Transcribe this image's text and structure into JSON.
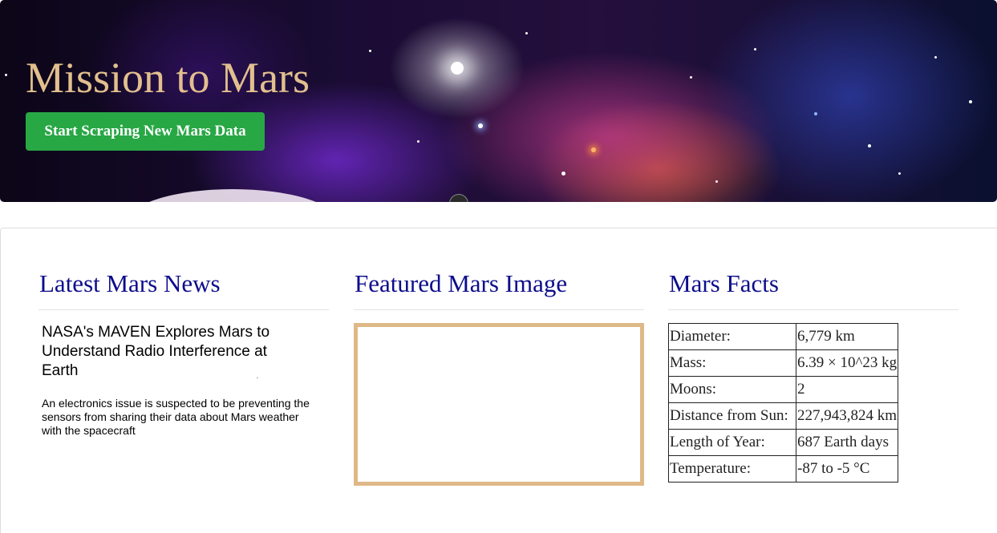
{
  "header": {
    "title": "Mission to Mars",
    "scrape_button": "Start Scraping New Mars Data"
  },
  "news": {
    "heading": "Latest Mars News",
    "title": "NASA's MAVEN Explores Mars to Understand Radio Interference at Earth",
    "body": "An electronics issue is suspected to be preventing the sensors from sharing their data about Mars weather with the spacecraft"
  },
  "featured_image": {
    "heading": "Featured Mars Image"
  },
  "facts": {
    "heading": "Mars Facts",
    "rows": [
      {
        "label": "Diameter:",
        "value": "6,779 km"
      },
      {
        "label": "Mass:",
        "value": "6.39 × 10^23 kg"
      },
      {
        "label": "Moons:",
        "value": "2"
      },
      {
        "label": "Distance from Sun:",
        "value": "227,943,824 km"
      },
      {
        "label": "Length of Year:",
        "value": "687 Earth days"
      },
      {
        "label": "Temperature:",
        "value": "-87 to -5 °C"
      }
    ]
  },
  "colors": {
    "title_gold": "#e2bf8e",
    "button_green": "#28a745",
    "heading_navy": "#0d0d8c",
    "image_border": "#deb887"
  }
}
